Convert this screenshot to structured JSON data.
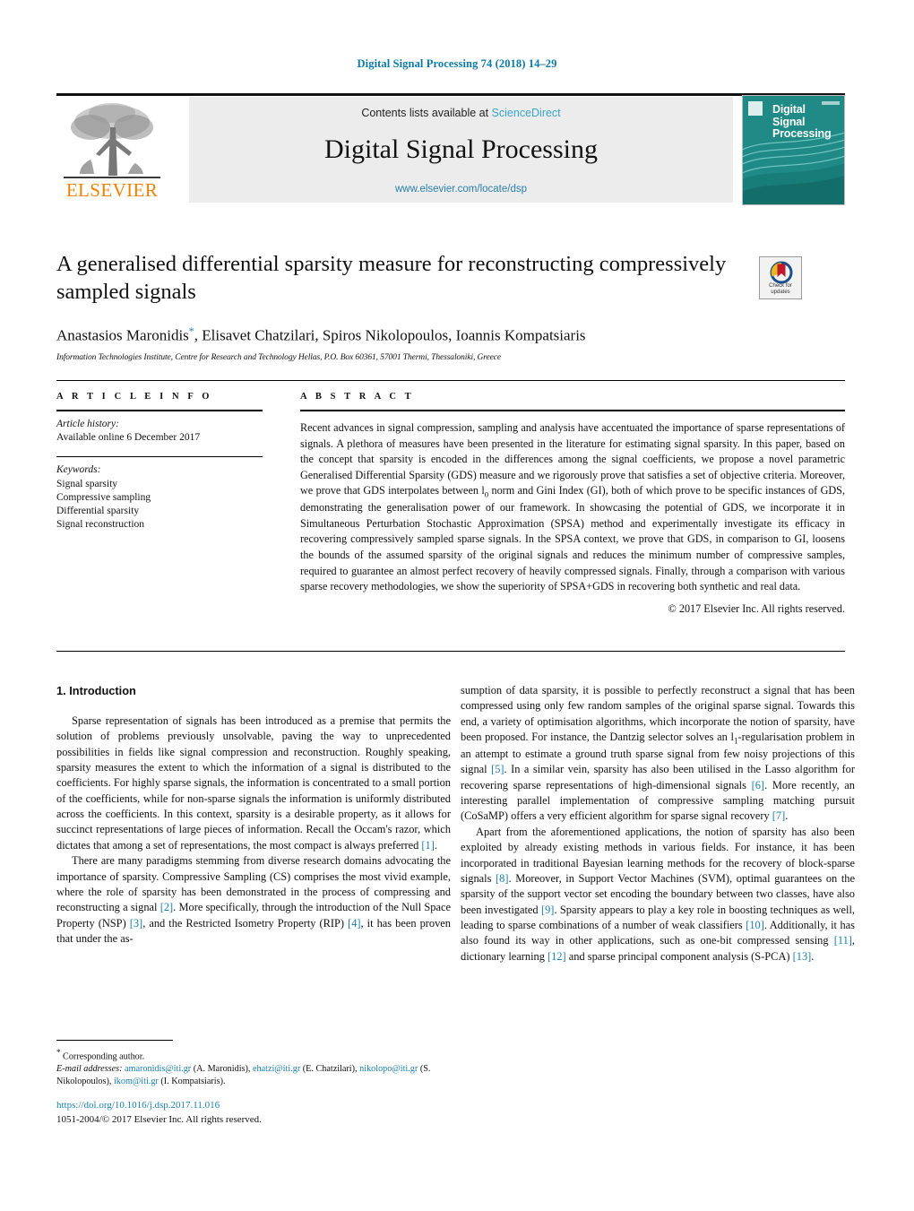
{
  "running_head": "Digital Signal Processing 74 (2018) 14–29",
  "masthead": {
    "contents_prefix": "Contents lists available at ",
    "sciencedirect": "ScienceDirect",
    "journal_name": "Digital Signal Processing",
    "journal_url": "www.elsevier.com/locate/dsp",
    "publisher": "ELSEVIER",
    "cover_title": "Digital\nSignal\nProcessing",
    "cover_color": "#1f8a86",
    "link_color": "#3aa3c9"
  },
  "article": {
    "title": "A generalised differential sparsity measure for reconstructing compressively sampled signals",
    "authors": "Anastasios Maronidis , Elisavet Chatzilari, Spiros Nikolopoulos, Ioannis Kompatsiaris",
    "author_star": "*",
    "affiliation": "Information Technologies Institute, Centre for Research and Technology Hellas, P.O. Box 60361, 57001 Thermi, Thessaloniki, Greece",
    "crossmark_label": "Check for\nupdates"
  },
  "info": {
    "heading": "A R T I C L E   I N F O",
    "history_label": "Article history:",
    "history_value": "Available online 6 December 2017",
    "keywords_label": "Keywords:",
    "keywords": [
      "Signal sparsity",
      "Compressive sampling",
      "Differential sparsity",
      "Signal reconstruction"
    ]
  },
  "abstract": {
    "heading": "A B S T R A C T",
    "text": "Recent advances in signal compression, sampling and analysis have accentuated the importance of sparse representations of signals. A plethora of measures have been presented in the literature for estimating signal sparsity. In this paper, based on the concept that sparsity is encoded in the differences among the signal coefficients, we propose a novel parametric Generalised Differential Sparsity (GDS) measure and we rigorously prove that satisfies a set of objective criteria. Moreover, we prove that GDS interpolates between l0 norm and Gini Index (GI), both of which prove to be specific instances of GDS, demonstrating the generalisation power of our framework. In showcasing the potential of GDS, we incorporate it in Simultaneous Perturbation Stochastic Approximation (SPSA) method and experimentally investigate its efficacy in recovering compressively sampled sparse signals. In the SPSA context, we prove that GDS, in comparison to GI, loosens the bounds of the assumed sparsity of the original signals and reduces the minimum number of compressive samples, required to guarantee an almost perfect recovery of heavily compressed signals. Finally, through a comparison with various sparse recovery methodologies, we show the superiority of SPSA+GDS in recovering both synthetic and real data.",
    "copyright": "© 2017 Elsevier Inc. All rights reserved."
  },
  "body": {
    "section_heading": "1. Introduction",
    "left_paragraphs": [
      "Sparse representation of signals has been introduced as a premise that permits the solution of problems previously unsolvable, paving the way to unprecedented possibilities in fields like signal compression and reconstruction. Roughly speaking, sparsity measures the extent to which the information of a signal is distributed to the coefficients. For highly sparse signals, the information is concentrated to a small portion of the coefficients, while for non-sparse signals the information is uniformly distributed across the coefficients. In this context, sparsity is a desirable property, as it allows for succinct representations of large pieces of information. Recall the Occam's razor, which dictates that among a set of representations, the most compact is always preferred [1].",
      "There are many paradigms stemming from diverse research domains advocating the importance of sparsity. Compressive Sampling (CS) comprises the most vivid example, where the role of sparsity has been demonstrated in the process of compressing and reconstructing a signal [2]. More specifically, through the introduction of the Null Space Property (NSP) [3], and the Restricted Isometry Property (RIP) [4], it has been proven that under the as-"
    ],
    "right_paragraphs": [
      "sumption of data sparsity, it is possible to perfectly reconstruct a signal that has been compressed using only few random samples of the original sparse signal. Towards this end, a variety of optimisation algorithms, which incorporate the notion of sparsity, have been proposed. For instance, the Dantzig selector solves an l1-regularisation problem in an attempt to estimate a ground truth sparse signal from few noisy projections of this signal [5]. In a similar vein, sparsity has also been utilised in the Lasso algorithm for recovering sparse representations of high-dimensional signals [6]. More recently, an interesting parallel implementation of compressive sampling matching pursuit (CoSaMP) offers a very efficient algorithm for sparse signal recovery [7].",
      "Apart from the aforementioned applications, the notion of sparsity has also been exploited by already existing methods in various fields. For instance, it has been incorporated in traditional Bayesian learning methods for the recovery of block-sparse signals [8]. Moreover, in Support Vector Machines (SVM), optimal guarantees on the sparsity of the support vector set encoding the boundary between two classes, have also been investigated [9]. Sparsity appears to play a key role in boosting techniques as well, leading to sparse combinations of a number of weak classifiers [10]. Additionally, it has also found its way in other applications, such as one-bit compressed sensing [11], dictionary learning [12] and sparse principal component analysis (S-PCA) [13]."
    ]
  },
  "footnote": {
    "corresponding": "Corresponding author.",
    "star": "*",
    "email_label": "E-mail addresses:",
    "emails": [
      {
        "address": "amaronidis@iti.gr",
        "name": "(A. Maronidis),"
      },
      {
        "address": "ehatzi@iti.gr",
        "name": "(E. Chatzilari),"
      },
      {
        "address": "nikolopo@iti.gr",
        "name": "(S. Nikolopoulos),"
      },
      {
        "address": "ikom@iti.gr",
        "name": "(I. Kompatsiaris)."
      }
    ]
  },
  "imprint": {
    "doi": "https://doi.org/10.1016/j.dsp.2017.11.016",
    "issn_line": "1051-2004/© 2017 Elsevier Inc. All rights reserved."
  }
}
